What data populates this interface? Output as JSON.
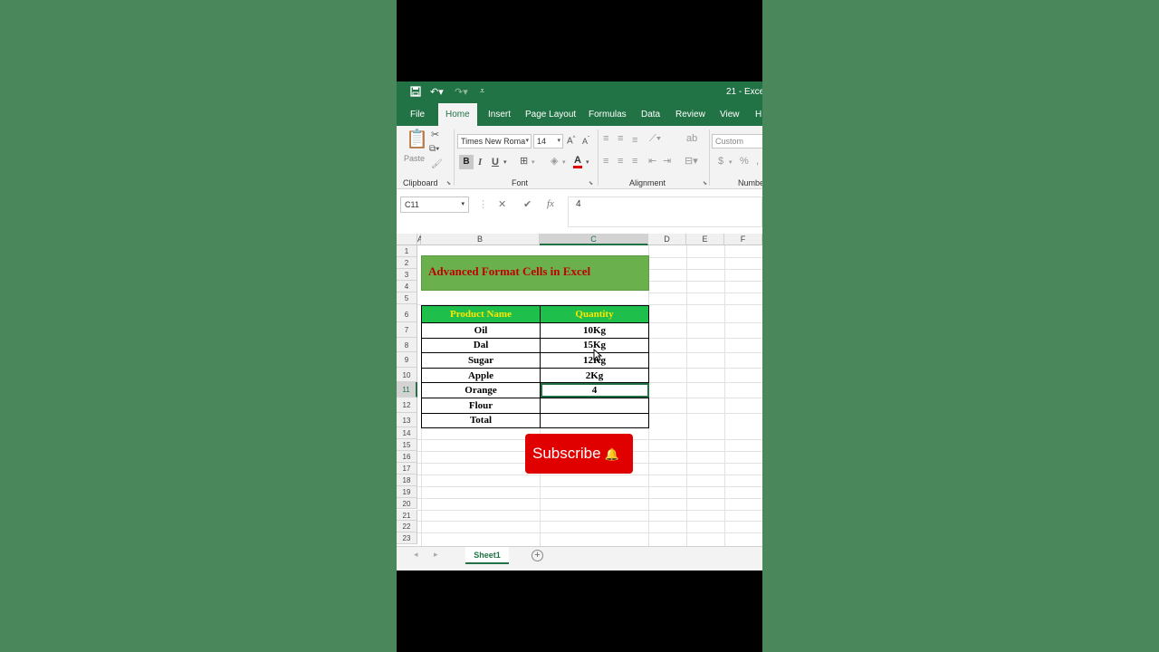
{
  "titlebar": {
    "doc_title": "21 - Exce",
    "save_icon": "save-icon",
    "undo_icon": "undo-icon",
    "redo_icon": "redo-icon"
  },
  "tabs": [
    "File",
    "Home",
    "Insert",
    "Page Layout",
    "Formulas",
    "Data",
    "Review",
    "View",
    "H"
  ],
  "ribbon": {
    "clipboard_label": "Clipboard",
    "paste_label": "Paste",
    "font_label": "Font",
    "alignment_label": "Alignment",
    "number_label": "Numbe",
    "font_name": "Times New Roma",
    "font_size": "14",
    "number_format": "Custom",
    "bold": "B",
    "italic": "I",
    "underline": "U",
    "grow_font": "A",
    "shrink_font": "A",
    "font_color": "A",
    "currency": "$",
    "percent": "%"
  },
  "formula_bar": {
    "name_box": "C11",
    "cancel": "✕",
    "enter": "✔",
    "fx": "fx",
    "value": "4"
  },
  "columns": [
    "A",
    "B",
    "C",
    "D",
    "E",
    "F"
  ],
  "rows": [
    "1",
    "2",
    "3",
    "4",
    "5",
    "6",
    "7",
    "8",
    "9",
    "10",
    "11",
    "12",
    "13",
    "14",
    "15",
    "16",
    "17",
    "18",
    "19",
    "20",
    "21",
    "22",
    "23"
  ],
  "sheet_title": "Advanced Format Cells in Excel",
  "table": {
    "headers": [
      "Product Name",
      "Quantity"
    ],
    "rows": [
      [
        "Oil",
        "10Kg"
      ],
      [
        "Dal",
        "15Kg"
      ],
      [
        "Sugar",
        "12Kg"
      ],
      [
        "Apple",
        "2Kg"
      ],
      [
        "Orange",
        "4"
      ],
      [
        "Flour",
        ""
      ],
      [
        "Total",
        ""
      ]
    ]
  },
  "subscribe": "Subscribe",
  "sheet_tab": "Sheet1",
  "colors": {
    "excel_green": "#217346",
    "header_fill": "#1fbf4c",
    "header_text": "#ffe600",
    "title_fill": "#6ab04c",
    "title_text": "#c00000",
    "subscribe": "#e00000"
  }
}
